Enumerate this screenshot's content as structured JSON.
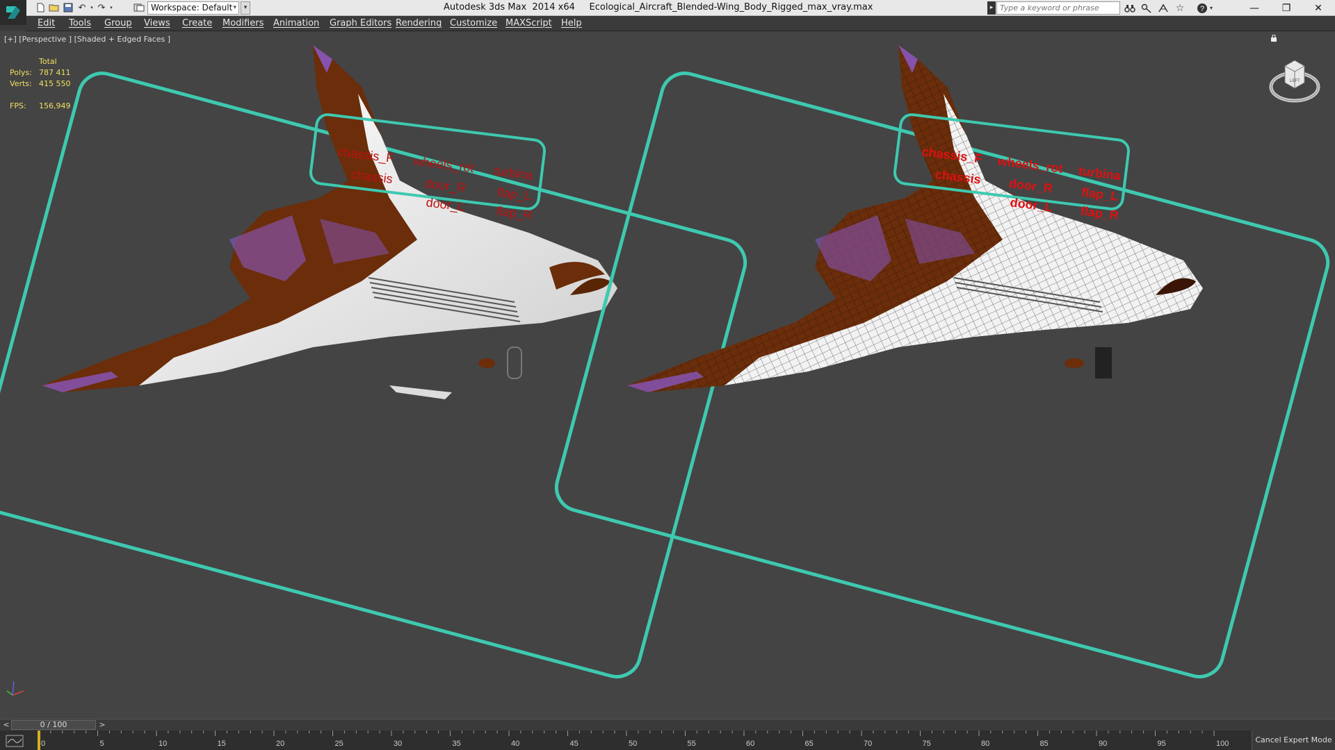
{
  "app": {
    "title": "Autodesk 3ds Max  2014 x64     Ecological_Aircraft_Blended-Wing_Body_Rigged_max_vray.max",
    "workspace_label": "Workspace: Default",
    "search_placeholder": "Type a keyword or phrase"
  },
  "quick_access": [
    "new-file-icon",
    "open-file-icon",
    "save-file-icon",
    "undo-icon",
    "redo-icon",
    "project-folder-icon"
  ],
  "title_tools": [
    "binoculars-icon",
    "infocenter-key-icon",
    "communication-center-icon",
    "favorites-star-icon",
    "help-icon"
  ],
  "menu": [
    {
      "label": "Edit"
    },
    {
      "label": "Tools"
    },
    {
      "label": "Group"
    },
    {
      "label": "Views"
    },
    {
      "label": "Create"
    },
    {
      "label": "Modifiers"
    },
    {
      "label": "Animation"
    },
    {
      "label": "Graph Editors"
    },
    {
      "label": "Rendering"
    },
    {
      "label": "Customize"
    },
    {
      "label": "MAXScript"
    },
    {
      "label": "Help"
    }
  ],
  "viewport": {
    "label": "[+] [Perspective ] [Shaded + Edged Faces ]",
    "stats": {
      "header": "Total",
      "polys_label": "Polys:",
      "polys": "787 411",
      "verts_label": "Verts:",
      "verts": "415 550",
      "fps_label": "FPS:",
      "fps": "156,949"
    },
    "navcube_face": "LEFT",
    "rig_labels": [
      "chassis_F",
      "wheels_rot",
      "turbina",
      "chassis",
      "door_R",
      "flap_L",
      "door_L",
      "flap_R"
    ]
  },
  "timeline": {
    "frame": "0 / 100",
    "prev": "<",
    "next": ">",
    "ruler_ticks": [
      "0",
      "5",
      "10",
      "15",
      "20",
      "25",
      "30",
      "35",
      "40",
      "45",
      "50",
      "55",
      "60",
      "65",
      "70",
      "75",
      "80",
      "85",
      "90",
      "95",
      "100"
    ],
    "cancel_expert": "Cancel Expert Mode"
  },
  "colors": {
    "rig_frame": "#3ec9b0",
    "rig_text": "#d01010",
    "hull_brown": "#6b2d0a",
    "hull_white": "#f2f2f2",
    "purple": "#8c5cd6",
    "stats_yellow": "#f0e060"
  }
}
